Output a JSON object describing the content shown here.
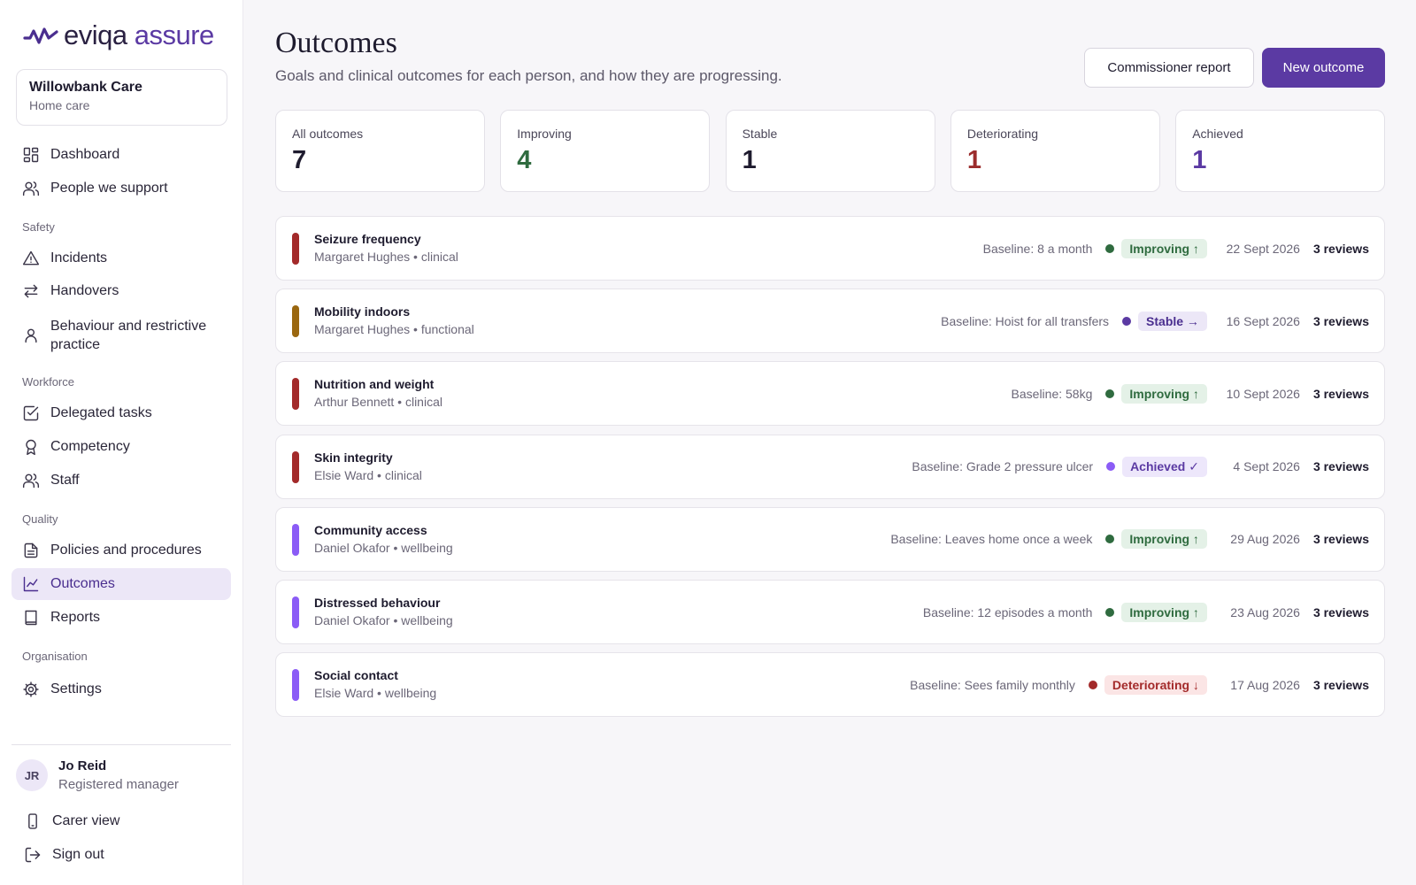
{
  "brand": {
    "name_part1": "eviqa",
    "name_part2": "assure"
  },
  "organisation": {
    "name": "Willowbank Care",
    "type": "Home care"
  },
  "nav": {
    "dashboard": "Dashboard",
    "people": "People we support",
    "section_safety": "Safety",
    "incidents": "Incidents",
    "handovers": "Handovers",
    "behaviour": "Behaviour and restrictive practice",
    "section_workforce": "Workforce",
    "delegated": "Delegated tasks",
    "competency": "Competency",
    "staff": "Staff",
    "section_quality": "Quality",
    "policies": "Policies and procedures",
    "outcomes": "Outcomes",
    "reports": "Reports",
    "section_organisation": "Organisation",
    "settings": "Settings"
  },
  "user": {
    "initials": "JR",
    "name": "Jo Reid",
    "role": "Registered manager"
  },
  "footer_links": {
    "carer_view": "Carer view",
    "sign_out": "Sign out"
  },
  "page": {
    "title": "Outcomes",
    "subtitle": "Goals and clinical outcomes for each person, and how they are progressing.",
    "commissioner_report": "Commissioner report",
    "new_outcome": "New outcome"
  },
  "stats": [
    {
      "label": "All outcomes",
      "value": "7",
      "color": "#1e1b2e"
    },
    {
      "label": "Improving",
      "value": "4",
      "color": "#2f6b3f"
    },
    {
      "label": "Stable",
      "value": "1",
      "color": "#1e1b2e"
    },
    {
      "label": "Deteriorating",
      "value": "1",
      "color": "#9b2c2c"
    },
    {
      "label": "Achieved",
      "value": "1",
      "color": "#5b3aa3"
    }
  ],
  "status_colors": {
    "improving": {
      "dot": "#2f6b3f",
      "bg": "#e4f1e7",
      "fg": "#2f6b3f"
    },
    "stable": {
      "dot": "#5b3aa3",
      "bg": "#ece7f7",
      "fg": "#4a2e8f"
    },
    "achieved": {
      "dot": "#8b5cf6",
      "bg": "#ede7fb",
      "fg": "#5b3aa3"
    },
    "deteriorating": {
      "dot": "#a32a2a",
      "bg": "#fbe5e5",
      "fg": "#a32a2a"
    }
  },
  "outcomes": [
    {
      "title": "Seizure frequency",
      "meta": "Margaret Hughes • clinical",
      "bar_color": "#a32a2a",
      "baseline": "Baseline: 8 a month",
      "status": "improving",
      "status_label": "Improving ↑",
      "date": "22 Sept 2026",
      "reviews": "3 reviews"
    },
    {
      "title": "Mobility indoors",
      "meta": "Margaret Hughes • functional",
      "bar_color": "#9a6710",
      "baseline": "Baseline: Hoist for all transfers",
      "status": "stable",
      "status_label": "Stable →",
      "date": "16 Sept 2026",
      "reviews": "3 reviews"
    },
    {
      "title": "Nutrition and weight",
      "meta": "Arthur Bennett • clinical",
      "bar_color": "#a32a2a",
      "baseline": "Baseline: 58kg",
      "status": "improving",
      "status_label": "Improving ↑",
      "date": "10 Sept 2026",
      "reviews": "3 reviews"
    },
    {
      "title": "Skin integrity",
      "meta": "Elsie Ward • clinical",
      "bar_color": "#a32a2a",
      "baseline": "Baseline: Grade 2 pressure ulcer",
      "status": "achieved",
      "status_label": "Achieved ✓",
      "date": "4 Sept 2026",
      "reviews": "3 reviews"
    },
    {
      "title": "Community access",
      "meta": "Daniel Okafor • wellbeing",
      "bar_color": "#8b5cf6",
      "baseline": "Baseline: Leaves home once a week",
      "status": "improving",
      "status_label": "Improving ↑",
      "date": "29 Aug 2026",
      "reviews": "3 reviews"
    },
    {
      "title": "Distressed behaviour",
      "meta": "Daniel Okafor • wellbeing",
      "bar_color": "#8b5cf6",
      "baseline": "Baseline: 12 episodes a month",
      "status": "improving",
      "status_label": "Improving ↑",
      "date": "23 Aug 2026",
      "reviews": "3 reviews"
    },
    {
      "title": "Social contact",
      "meta": "Elsie Ward • wellbeing",
      "bar_color": "#8b5cf6",
      "baseline": "Baseline: Sees family monthly",
      "status": "deteriorating",
      "status_label": "Deteriorating ↓",
      "date": "17 Aug 2026",
      "reviews": "3 reviews"
    }
  ]
}
